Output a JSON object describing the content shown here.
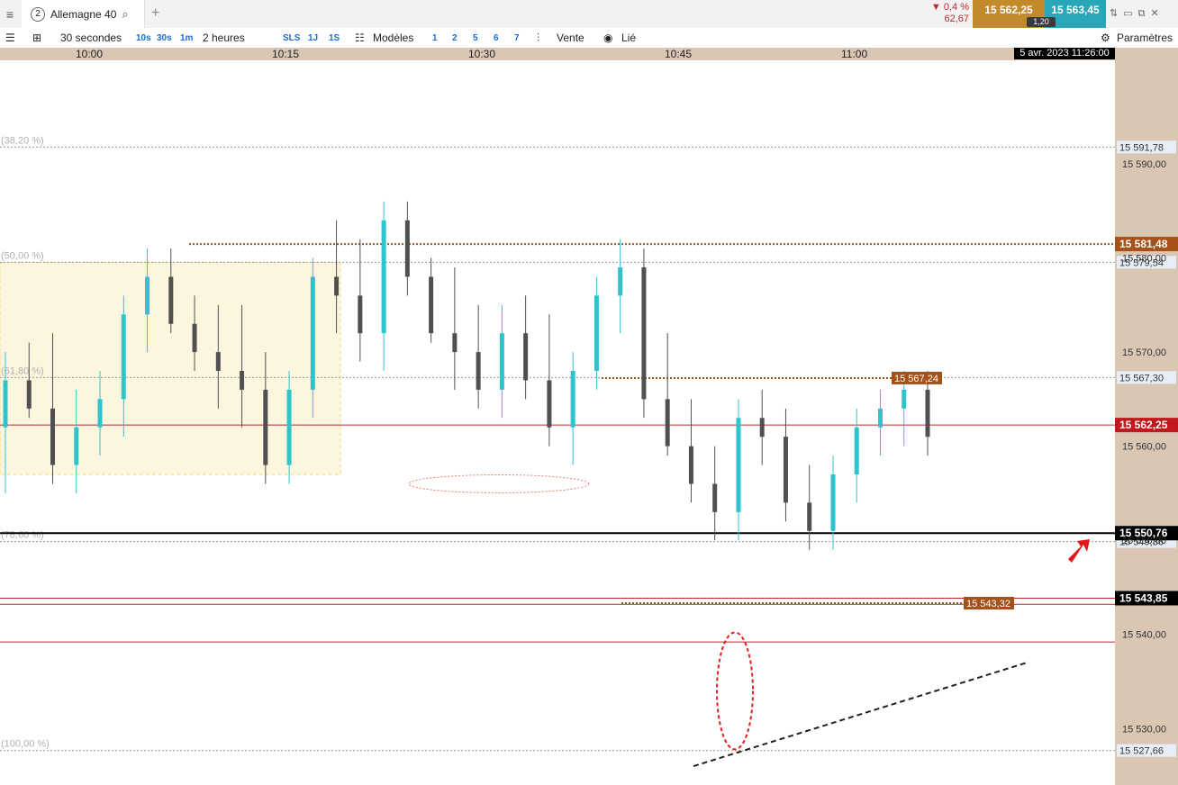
{
  "tabbar": {
    "tab_number": "2",
    "instrument": "Allemagne 40",
    "search_icon": "search-icon",
    "add_icon": "plus-icon",
    "change_percent": "▼ 0,4 %",
    "change_points": "62,67",
    "sell_price": "15 562,25",
    "buy_price": "15 563,45",
    "spread": "1,20"
  },
  "toolbar": {
    "interval": "30 secondes",
    "q10s": "10s",
    "q30s": "30s",
    "q1m": "1m",
    "range": "2 heures",
    "sls": "SLS",
    "q1j": "1J",
    "q1s": "1S",
    "models": "Modèles",
    "n1": "1",
    "n2": "2",
    "n5": "5",
    "n6": "6",
    "n7": "7",
    "sell_label": "Vente",
    "linked_label": "Lié",
    "settings_label": "Paramètres"
  },
  "colors": {
    "up": "#2ec4cc",
    "down": "#505050",
    "level": "#c0282d",
    "fib_zone": "#fdf6df",
    "sell_bg": "#c38a2b",
    "buy_bg": "#2aa6b9",
    "axis_bg": "#d9c7b3"
  },
  "chart_data": {
    "type": "candlestick",
    "x_ticks": [
      "10:00",
      "10:15",
      "10:30",
      "10:45",
      "11:00"
    ],
    "date_label": "5 avr. 2023 11:26:00",
    "y_ticks": [
      "15 590,00",
      "15 580,00",
      "15 570,00",
      "15 560,00",
      "15 550,00",
      "15 540,00",
      "15 530,00"
    ],
    "ylim": [
      15524,
      15601
    ],
    "fib_levels": [
      {
        "label": "(38,20 %)",
        "value": 15591.78,
        "tag": "15 591,78"
      },
      {
        "label": "(50,00 %)",
        "value": 15579.54,
        "tag": "15 579,54"
      },
      {
        "label": "(61,80 %)",
        "value": 15567.3,
        "tag": "15 567,30"
      },
      {
        "label": "(78,60 %)",
        "value": 15549.86,
        "tag": "15 549,86"
      },
      {
        "label": "(100,00 %)",
        "value": 15527.66,
        "tag": "15 527,66"
      }
    ],
    "price_tags": {
      "resistance_dotted": "15 581,48",
      "high_dotted": "15 567,24",
      "current": "15 562,25",
      "black_line": "15 550,76",
      "support": "15 543,85",
      "support_dotted": "15 543,32"
    },
    "levels": {
      "resistance_dotted": 15581.48,
      "high_dotted": 15567.24,
      "current": 15562.25,
      "black_line": 15550.76,
      "support": 15543.85,
      "support_dotted": 15543.32,
      "red_low": 15543.2,
      "red_lower": 15539.2
    },
    "candles": [
      [
        15562,
        15570,
        15555,
        15567
      ],
      [
        15567,
        15571,
        15563,
        15564
      ],
      [
        15564,
        15572,
        15556,
        15558
      ],
      [
        15558,
        15566,
        15555,
        15562
      ],
      [
        15562,
        15568,
        15559,
        15565
      ],
      [
        15565,
        15576,
        15561,
        15574
      ],
      [
        15574,
        15581,
        15570,
        15578
      ],
      [
        15578,
        15581,
        15572,
        15573
      ],
      [
        15573,
        15576,
        15568,
        15570
      ],
      [
        15570,
        15575,
        15564,
        15568
      ],
      [
        15568,
        15575,
        15562,
        15566
      ],
      [
        15566,
        15570,
        15556,
        15558
      ],
      [
        15558,
        15568,
        15556,
        15566
      ],
      [
        15566,
        15580,
        15563,
        15578
      ],
      [
        15578,
        15584,
        15572,
        15576
      ],
      [
        15576,
        15582,
        15569,
        15572
      ],
      [
        15572,
        15586,
        15568,
        15584
      ],
      [
        15584,
        15586,
        15576,
        15578
      ],
      [
        15578,
        15580,
        15571,
        15572
      ],
      [
        15572,
        15579,
        15566,
        15570
      ],
      [
        15570,
        15575,
        15564,
        15566
      ],
      [
        15566,
        15575,
        15563,
        15572
      ],
      [
        15572,
        15576,
        15565,
        15567
      ],
      [
        15567,
        15574,
        15560,
        15562
      ],
      [
        15562,
        15570,
        15558,
        15568
      ],
      [
        15568,
        15578,
        15566,
        15576
      ],
      [
        15576,
        15582,
        15572,
        15579
      ],
      [
        15579,
        15581,
        15563,
        15565
      ],
      [
        15565,
        15572,
        15559,
        15560
      ],
      [
        15560,
        15565,
        15554,
        15556
      ],
      [
        15556,
        15560,
        15550,
        15553
      ],
      [
        15553,
        15565,
        15550,
        15563
      ],
      [
        15563,
        15566,
        15558,
        15561
      ],
      [
        15561,
        15564,
        15552,
        15554
      ],
      [
        15554,
        15558,
        15549,
        15551
      ],
      [
        15551,
        15559,
        15549,
        15557
      ],
      [
        15557,
        15564,
        15554,
        15562
      ],
      [
        15562,
        15566,
        15559,
        15564
      ],
      [
        15564,
        15568,
        15560,
        15566
      ],
      [
        15566,
        15568,
        15559,
        15561
      ]
    ]
  }
}
